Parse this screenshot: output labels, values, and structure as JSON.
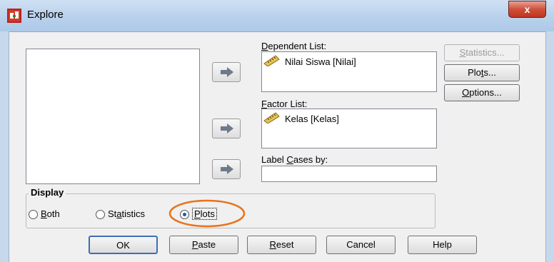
{
  "window": {
    "title": "Explore",
    "close_glyph": "x"
  },
  "dependent_list": {
    "label_pre": "",
    "label_ul": "D",
    "label_post": "ependent List:",
    "items": [
      "Nilai Siswa [Nilai]"
    ]
  },
  "factor_list": {
    "label_pre": "",
    "label_ul": "F",
    "label_post": "actor List:",
    "items": [
      "Kelas [Kelas]"
    ]
  },
  "label_cases": {
    "label_pre": "Label ",
    "label_ul": "C",
    "label_post": "ases by:",
    "value": ""
  },
  "side_buttons": {
    "statistics": {
      "pre": "",
      "ul": "S",
      "post": "tatistics...",
      "enabled": false
    },
    "plots": {
      "pre": "Plo",
      "ul": "t",
      "post": "s...",
      "enabled": true
    },
    "options": {
      "pre": "",
      "ul": "O",
      "post": "ptions...",
      "enabled": true
    }
  },
  "display": {
    "legend": "Display",
    "options": [
      {
        "pre": "",
        "ul": "B",
        "post": "oth",
        "selected": false
      },
      {
        "pre": "St",
        "ul": "a",
        "post": "tistics",
        "selected": false
      },
      {
        "pre": "",
        "ul": "P",
        "post": "lots",
        "selected": true
      }
    ]
  },
  "bottom_buttons": {
    "ok": {
      "pre": "OK",
      "ul": "",
      "post": ""
    },
    "paste": {
      "pre": "",
      "ul": "P",
      "post": "aste"
    },
    "reset": {
      "pre": "",
      "ul": "R",
      "post": "eset"
    },
    "cancel": {
      "pre": "Cancel",
      "ul": "",
      "post": ""
    },
    "help": {
      "pre": "Help",
      "ul": "",
      "post": ""
    }
  },
  "colors": {
    "highlight_circle": "#e8731e",
    "title_gradient": "#b9d1ec",
    "close_red": "#c0341f"
  },
  "icons": {
    "title": "spss-explore-icon",
    "variable": "ruler-scale-icon",
    "move": "right-arrow-icon"
  }
}
